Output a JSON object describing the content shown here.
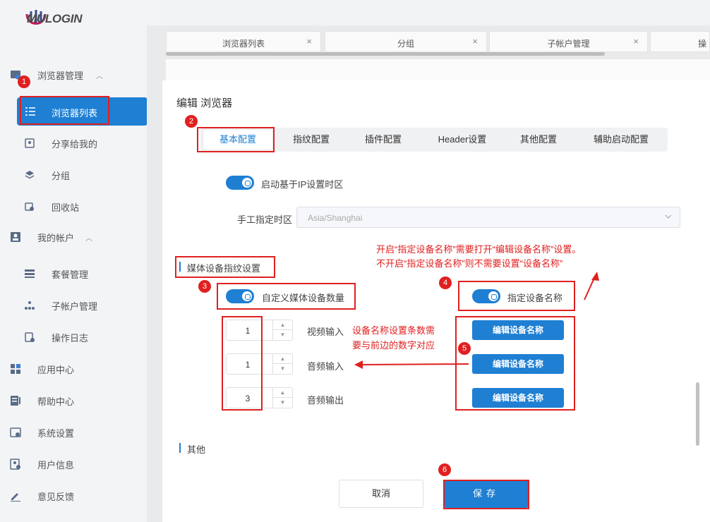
{
  "logo": {
    "text": "MULOGIN"
  },
  "sidebar": {
    "groups": [
      {
        "label": "浏览器管理",
        "icon": "browser-manage-icon"
      },
      {
        "label": "我的帐户",
        "icon": "account-icon"
      },
      {
        "label": "应用中心",
        "icon": "app-center-icon"
      },
      {
        "label": "帮助中心",
        "icon": "help-center-icon"
      },
      {
        "label": "系统设置",
        "icon": "system-settings-icon"
      },
      {
        "label": "用户信息",
        "icon": "user-info-icon"
      },
      {
        "label": "意见反馈",
        "icon": "feedback-icon"
      }
    ],
    "browser_items": [
      {
        "label": "浏览器列表",
        "icon": "list-icon"
      },
      {
        "label": "分享给我的",
        "icon": "share-icon"
      },
      {
        "label": "分组",
        "icon": "layers-icon"
      },
      {
        "label": "回收站",
        "icon": "recycle-icon"
      }
    ],
    "account_items": [
      {
        "label": "套餐管理",
        "icon": "plan-icon"
      },
      {
        "label": "子帐户管理",
        "icon": "sub-account-icon"
      },
      {
        "label": "操作日志",
        "icon": "log-icon"
      }
    ]
  },
  "top_tabs": [
    {
      "label": "浏览器列表"
    },
    {
      "label": "分组"
    },
    {
      "label": "子帐户管理"
    },
    {
      "label": "操"
    }
  ],
  "dialog": {
    "title": "编辑 浏览器",
    "tabs": [
      "基本配置",
      "指纹配置",
      "插件配置",
      "Header设置",
      "其他配置",
      "辅助启动配置"
    ],
    "ip_timezone_label": "启动基于IP设置时区",
    "manual_tz_label": "手工指定时区",
    "manual_tz_value": "Asia/Shanghai",
    "media_section": "媒体设备指纹设置",
    "custom_media_label": "自定义媒体设备数量",
    "device_name_label": "指定设备名称",
    "rows": [
      {
        "value": "1",
        "label": "视频输入",
        "button": "编辑设备名称"
      },
      {
        "value": "1",
        "label": "音频输入",
        "button": "编辑设备名称"
      },
      {
        "value": "3",
        "label": "音频输出",
        "button": "编辑设备名称"
      }
    ],
    "other_section": "其他",
    "cancel": "取消",
    "save": "保存"
  },
  "annotations": {
    "badges": [
      "1",
      "2",
      "3",
      "4",
      "5",
      "6"
    ],
    "note_top_line1": "开启“指定设备名称”需要打开“编辑设备名称”设置。",
    "note_top_line2": "不开启“指定设备名称”则不需要设置“设备名称”",
    "note_mid_line1": "设备名称设置条数需",
    "note_mid_line2": "要与前边的数字对应"
  },
  "colors": {
    "accent": "#1e7fd3",
    "annotation": "#e02020"
  }
}
